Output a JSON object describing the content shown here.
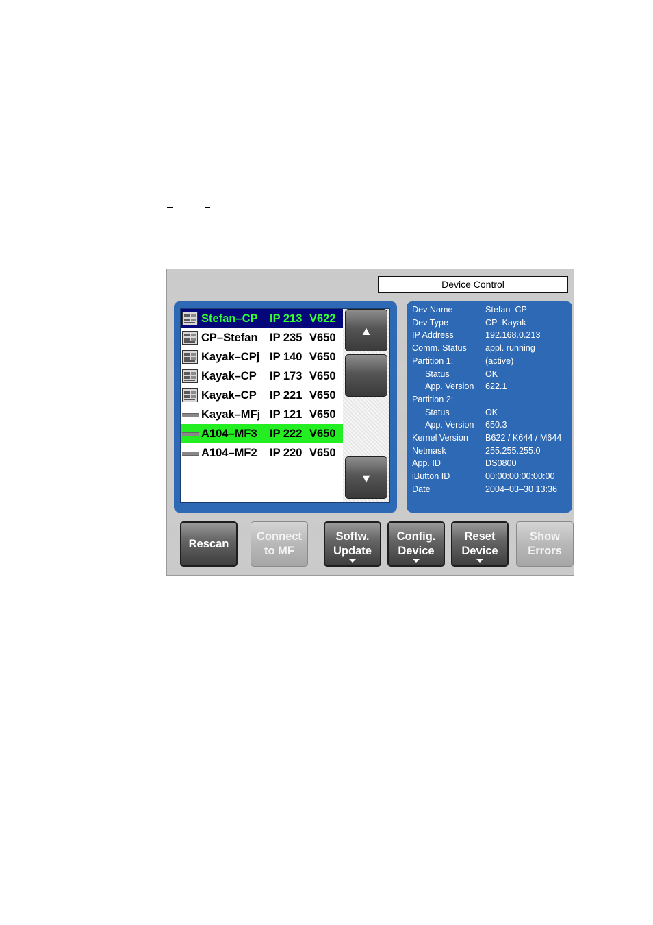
{
  "window": {
    "title": "Device Control"
  },
  "devices": [
    {
      "icon": "control-panel-icon",
      "name": "Stefan–CP",
      "ip": "IP 213",
      "version": "V622",
      "state": "selected"
    },
    {
      "icon": "control-panel-icon",
      "name": "CP–Stefan",
      "ip": "IP 235",
      "version": "V650",
      "state": "normal"
    },
    {
      "icon": "control-panel-icon",
      "name": "Kayak–CPj",
      "ip": "IP 140",
      "version": "V650",
      "state": "normal"
    },
    {
      "icon": "control-panel-icon",
      "name": "Kayak–CP",
      "ip": "IP 173",
      "version": "V650",
      "state": "normal"
    },
    {
      "icon": "control-panel-icon",
      "name": "Kayak–CP",
      "ip": "IP 221",
      "version": "V650",
      "state": "normal"
    },
    {
      "icon": "mainframe-icon",
      "name": "Kayak–MFj",
      "ip": "IP 121",
      "version": "V650",
      "state": "normal"
    },
    {
      "icon": "mainframe-icon",
      "name": "A104–MF3",
      "ip": "IP 222",
      "version": "V650",
      "state": "highlight"
    },
    {
      "icon": "mainframe-icon",
      "name": "A104–MF2",
      "ip": "IP 220",
      "version": "V650",
      "state": "normal"
    }
  ],
  "scroll": {
    "up_icon": "triangle-up-icon",
    "down_icon": "triangle-down-icon"
  },
  "details": [
    {
      "label": "Dev Name",
      "value": "Stefan–CP"
    },
    {
      "label": "Dev Type",
      "value": "CP–Kayak"
    },
    {
      "label": "IP Address",
      "value": "192.168.0.213"
    },
    {
      "label": "Comm. Status",
      "value": "appl. running"
    },
    {
      "label": "Partition 1:",
      "value": "(active)"
    },
    {
      "label": "Status",
      "value": "OK",
      "indent": true
    },
    {
      "label": "App. Version",
      "value": "622.1",
      "indent": true
    },
    {
      "label": "Partition 2:",
      "value": ""
    },
    {
      "label": "Status",
      "value": "OK",
      "indent": true
    },
    {
      "label": "App. Version",
      "value": "650.3",
      "indent": true
    },
    {
      "label": "Kernel Version",
      "value": "B622 / K644 / M644"
    },
    {
      "label": "Netmask",
      "value": "255.255.255.0"
    },
    {
      "label": "App. ID",
      "value": "DS0800"
    },
    {
      "label": "iButton ID",
      "value": "00:00:00:00:00:00"
    },
    {
      "label": "Date",
      "value": "2004–03–30  13:36"
    }
  ],
  "buttons": [
    {
      "line1": "Rescan",
      "line2": "",
      "enabled": true,
      "dropdown": false
    },
    {
      "line1": "Connect",
      "line2": "to MF",
      "enabled": false,
      "dropdown": false
    },
    {
      "line1": "Softw.",
      "line2": "Update",
      "enabled": true,
      "dropdown": true
    },
    {
      "line1": "Config.",
      "line2": "Device",
      "enabled": true,
      "dropdown": true
    },
    {
      "line1": "Reset",
      "line2": "Device",
      "enabled": true,
      "dropdown": true
    },
    {
      "line1": "Show",
      "line2": "Errors",
      "enabled": false,
      "dropdown": false
    }
  ],
  "colors": {
    "panel_blue": "#2d69b4",
    "selected_row_bg": "#05067a",
    "selected_row_text": "#33ff33",
    "highlight_row_bg": "#22ee22"
  }
}
